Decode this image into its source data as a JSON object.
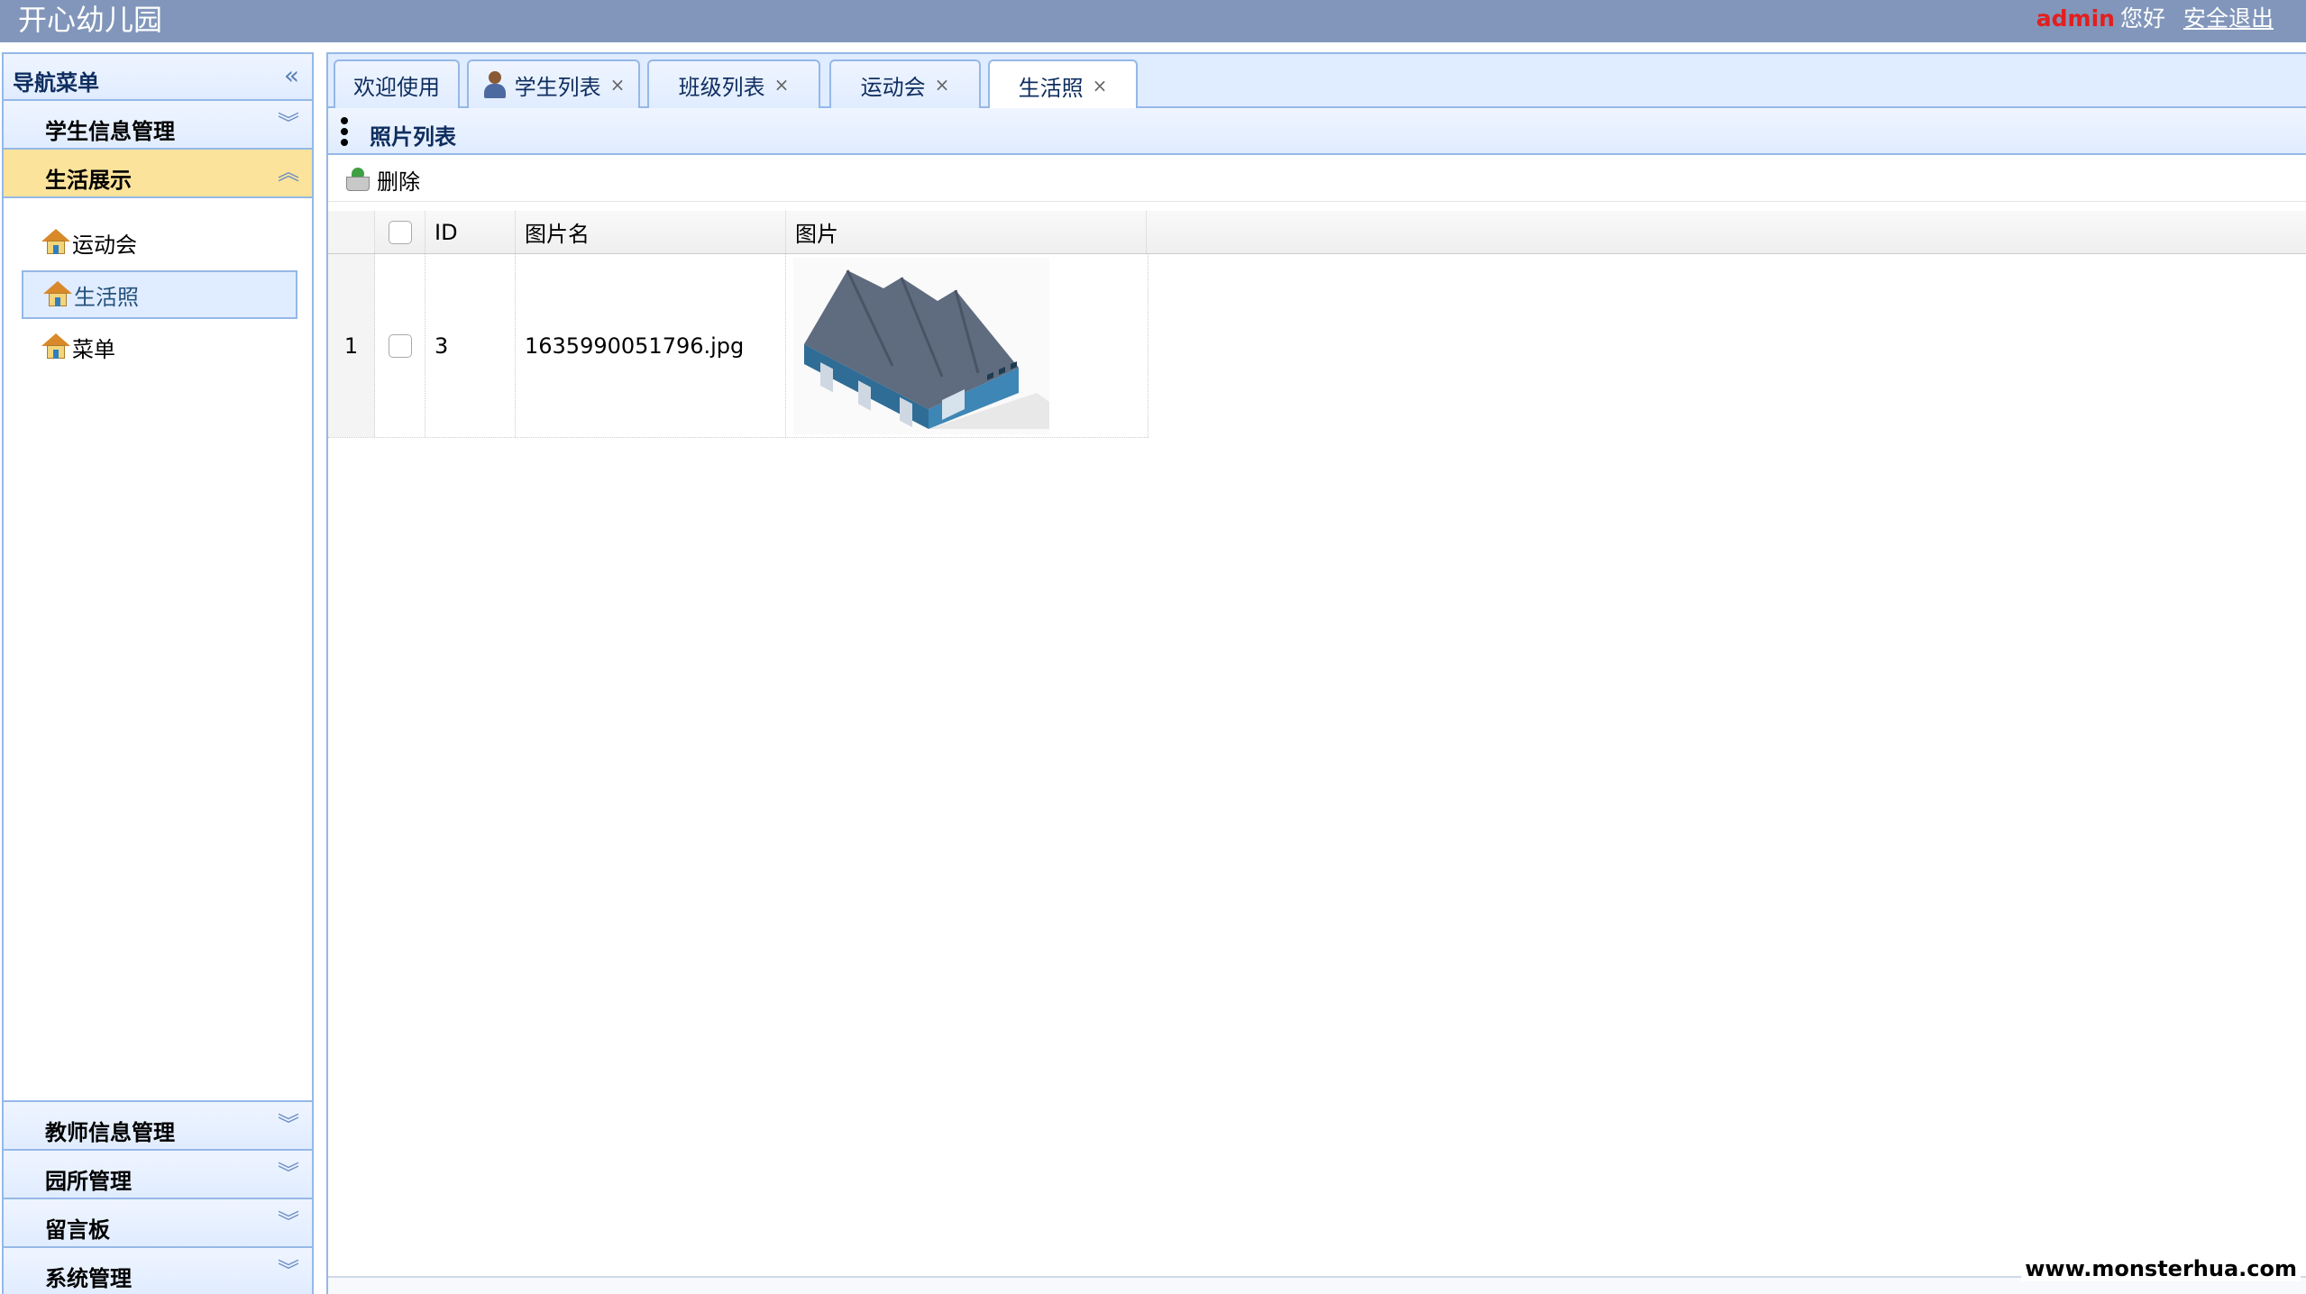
{
  "header": {
    "app_title": "开心幼儿园",
    "user_name": "admin",
    "greeting": "您好",
    "logout_label": "安全退出"
  },
  "sidebar": {
    "title": "导航菜单",
    "sections": [
      {
        "label": "学生信息管理",
        "expanded": false
      },
      {
        "label": "生活展示",
        "expanded": true,
        "items": [
          {
            "label": "运动会",
            "selected": false
          },
          {
            "label": "生活照",
            "selected": true
          },
          {
            "label": "菜单",
            "selected": false
          }
        ]
      },
      {
        "label": "教师信息管理",
        "expanded": false
      },
      {
        "label": "园所管理",
        "expanded": false
      },
      {
        "label": "留言板",
        "expanded": false
      },
      {
        "label": "系统管理",
        "expanded": false
      }
    ]
  },
  "tabs": [
    {
      "label": "欢迎使用",
      "closable": false,
      "active": false
    },
    {
      "label": "学生列表",
      "closable": true,
      "active": false,
      "icon": "person-icon"
    },
    {
      "label": "班级列表",
      "closable": true,
      "active": false
    },
    {
      "label": "运动会",
      "closable": true,
      "active": false
    },
    {
      "label": "生活照",
      "closable": true,
      "active": true
    }
  ],
  "tab_close_glyph": "×",
  "panel": {
    "title": "照片列表",
    "toolbar": {
      "delete_label": "删除"
    }
  },
  "grid": {
    "columns": [
      "",
      "",
      "ID",
      "图片名",
      "图片"
    ],
    "rows": [
      {
        "rownum": "1",
        "id": "3",
        "name": "1635990051796.jpg",
        "image": "warehouse-illustration"
      }
    ]
  },
  "watermark": "www.monsterhua.com",
  "colors": {
    "header_bg": "#8196ba",
    "border": "#95b8e7",
    "active_section": "#fbe39b",
    "user_name": "#e21f1f"
  }
}
